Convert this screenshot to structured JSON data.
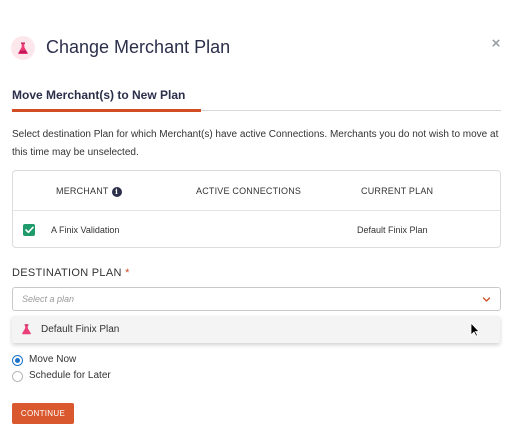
{
  "dialog": {
    "title": "Change Merchant Plan",
    "close_label": "×",
    "icon": "flask-icon"
  },
  "section": {
    "tab_label": "Move Merchant(s) to New Plan",
    "description": "Select destination Plan for which Merchant(s) have active Connections. Merchants you do not wish to move at this time may be unselected."
  },
  "table": {
    "headers": {
      "merchant": "MERCHANT",
      "merchant_info_icon": "info-icon",
      "active_connections": "ACTIVE CONNECTIONS",
      "current_plan": "CURRENT PLAN"
    },
    "rows": [
      {
        "checked": true,
        "merchant": "A Finix Validation",
        "active_connections": "",
        "current_plan": "Default Finix Plan"
      }
    ]
  },
  "destination": {
    "label": "DESTINATION PLAN",
    "required_marker": "*",
    "placeholder": "Select a plan",
    "options": [
      {
        "label": "Default Finix Plan",
        "icon": "flask-icon"
      }
    ]
  },
  "schedule": {
    "options": [
      {
        "label": "Move Now",
        "selected": true
      },
      {
        "label": "Schedule for Later",
        "selected": false
      }
    ]
  },
  "actions": {
    "continue_label": "CONTINUE"
  },
  "colors": {
    "accent": "#d14d24",
    "button": "#d9582e",
    "checkbox": "#1f9a6b",
    "radio": "#1e73c8",
    "title": "#2b2f4a"
  }
}
